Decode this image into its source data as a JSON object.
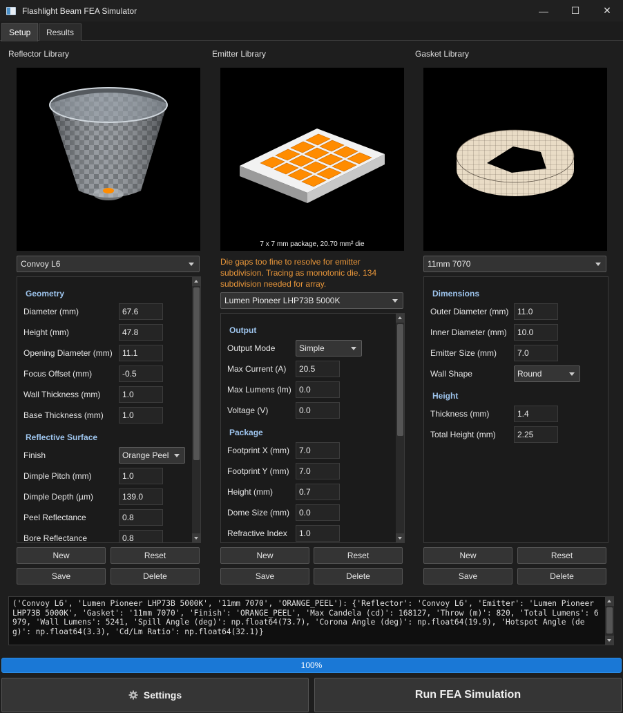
{
  "window": {
    "title": "Flashlight Beam FEA Simulator",
    "minimize": "—",
    "maximize": "☐",
    "close": "✕"
  },
  "tabs": [
    {
      "label": "Setup",
      "active": true
    },
    {
      "label": "Results",
      "active": false
    }
  ],
  "reflector": {
    "panel_label": "Reflector Library",
    "selected": "Convoy L6",
    "sections": {
      "geometry": "Geometry",
      "surface": "Reflective Surface"
    },
    "fields": [
      {
        "label": "Diameter (mm)",
        "value": "67.6"
      },
      {
        "label": "Height (mm)",
        "value": "47.8"
      },
      {
        "label": "Opening Diameter (mm)",
        "value": "11.1"
      },
      {
        "label": "Focus Offset (mm)",
        "value": "-0.5"
      },
      {
        "label": "Wall Thickness (mm)",
        "value": "1.0"
      },
      {
        "label": "Base Thickness (mm)",
        "value": "1.0"
      }
    ],
    "finish": {
      "label": "Finish",
      "value": "Orange Peel"
    },
    "surface_fields": [
      {
        "label": "Dimple Pitch (mm)",
        "value": "1.0"
      },
      {
        "label": "Dimple Depth (µm)",
        "value": "139.0"
      },
      {
        "label": "Peel Reflectance",
        "value": "0.8"
      },
      {
        "label": "Bore Reflectance",
        "value": "0.8"
      }
    ]
  },
  "emitter": {
    "panel_label": "Emitter Library",
    "caption": "7 x 7 mm package, 20.70 mm² die",
    "warning": "Die gaps too fine to resolve for emitter subdivision. Tracing as monotonic die. 134 subdivision needed for array.",
    "selected": "Lumen Pioneer LHP73B 5000K",
    "sections": {
      "output": "Output",
      "package": "Package"
    },
    "output_mode": {
      "label": "Output Mode",
      "value": "Simple"
    },
    "output_fields": [
      {
        "label": "Max Current (A)",
        "value": "20.5"
      },
      {
        "label": "Max Lumens (lm)",
        "value": "0.0"
      },
      {
        "label": "Voltage (V)",
        "value": "0.0"
      }
    ],
    "package_fields": [
      {
        "label": "Footprint X (mm)",
        "value": "7.0"
      },
      {
        "label": "Footprint Y (mm)",
        "value": "7.0"
      },
      {
        "label": "Height (mm)",
        "value": "0.7"
      },
      {
        "label": "Dome Size (mm)",
        "value": "0.0"
      },
      {
        "label": "Refractive Index",
        "value": "1.0"
      }
    ]
  },
  "gasket": {
    "panel_label": "Gasket Library",
    "selected": "11mm 7070",
    "sections": {
      "dimensions": "Dimensions",
      "height": "Height"
    },
    "dim_fields": [
      {
        "label": "Outer Diameter (mm)",
        "value": "11.0"
      },
      {
        "label": "Inner Diameter (mm)",
        "value": "10.0"
      },
      {
        "label": "Emitter Size (mm)",
        "value": "7.0"
      }
    ],
    "wall_shape": {
      "label": "Wall Shape",
      "value": "Round"
    },
    "height_fields": [
      {
        "label": "Thickness (mm)",
        "value": "1.4"
      },
      {
        "label": "Total Height (mm)",
        "value": "2.25"
      }
    ]
  },
  "buttons": {
    "new": "New",
    "reset": "Reset",
    "save": "Save",
    "delete": "Delete"
  },
  "log": "('Convoy L6', 'Lumen Pioneer LHP73B 5000K', '11mm 7070', 'ORANGE_PEEL'): {'Reflector': 'Convoy L6', 'Emitter': 'Lumen Pioneer LHP73B 5000K', 'Gasket': '11mm 7070', 'Finish': 'ORANGE_PEEL', 'Max Candela (cd)': 168127, 'Throw (m)': 820, 'Total Lumens': 6979, 'Wall Lumens': 5241, 'Spill Angle (deg)': np.float64(73.7), 'Corona Angle (deg)': np.float64(19.9), 'Hotspot Angle (deg)': np.float64(3.3), 'Cd/Lm Ratio': np.float64(32.1)}",
  "progress": {
    "text": "100%",
    "fraction": 1.0
  },
  "actions": {
    "settings": "Settings",
    "run": "Run FEA Simulation"
  },
  "colors": {
    "accent": "#1a78d6",
    "section_heading": "#9ec5ee",
    "warning": "#e8963a",
    "die_orange": "#ff8c00"
  }
}
